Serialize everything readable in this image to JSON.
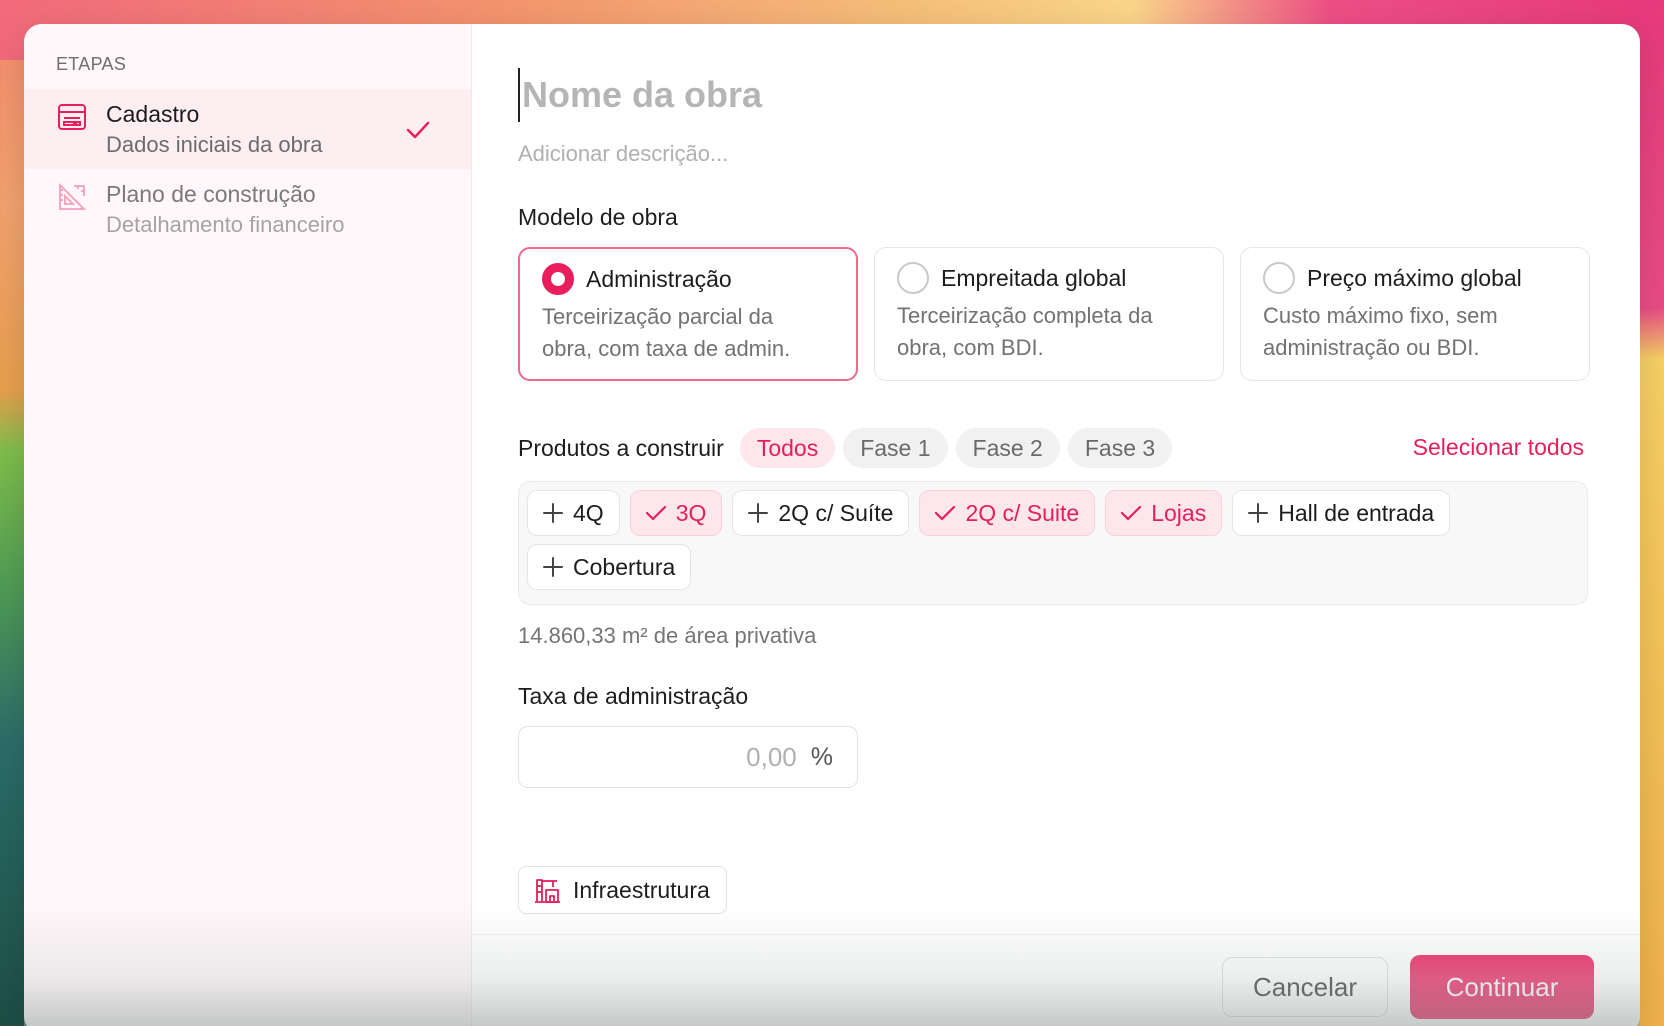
{
  "sidebar": {
    "heading": "ETAPAS",
    "steps": [
      {
        "title": "Cadastro",
        "subtitle": "Dados iniciais da obra",
        "icon": "form-icon",
        "active": true,
        "completed": true
      },
      {
        "title": "Plano de construção",
        "subtitle": "Detalhamento financeiro",
        "icon": "blueprint-icon",
        "active": false,
        "completed": false
      }
    ]
  },
  "form": {
    "name_placeholder": "Nome da obra",
    "description_placeholder": "Adicionar descrição...",
    "model_label": "Modelo de obra",
    "models": [
      {
        "title": "Administração",
        "desc_line1": "Terceirização parcial da",
        "desc_line2": "obra, com taxa de admin.",
        "selected": true
      },
      {
        "title": "Empreitada global",
        "desc_line1": "Terceirização completa da",
        "desc_line2": "obra, com BDI.",
        "selected": false
      },
      {
        "title": "Preço máximo global",
        "desc_line1": "Custo máximo fixo, sem",
        "desc_line2": "administração ou BDI.",
        "selected": false
      }
    ],
    "products_label": "Produtos a construir",
    "filters": [
      "Todos",
      "Fase 1",
      "Fase 2",
      "Fase 3"
    ],
    "active_filter": "Todos",
    "select_all": "Selecionar todos",
    "products": [
      {
        "label": "4Q",
        "selected": false
      },
      {
        "label": "3Q",
        "selected": true
      },
      {
        "label": "2Q c/ Suíte",
        "selected": false
      },
      {
        "label": "2Q c/ Suite",
        "selected": true
      },
      {
        "label": "Lojas",
        "selected": true
      },
      {
        "label": "Hall de entrada",
        "selected": false
      },
      {
        "label": "Cobertura",
        "selected": false
      }
    ],
    "area_text": "14.860,33 m² de área privativa",
    "fee_label": "Taxa de administração",
    "fee_placeholder": "0,00",
    "fee_unit": "%",
    "infra_label": "Infraestrutura"
  },
  "footer": {
    "cancel": "Cancelar",
    "continue": "Continuar"
  },
  "colors": {
    "accent": "#ea1d5d",
    "accent_soft": "#fde7ed",
    "sidebar_bg": "#fff7f9"
  }
}
